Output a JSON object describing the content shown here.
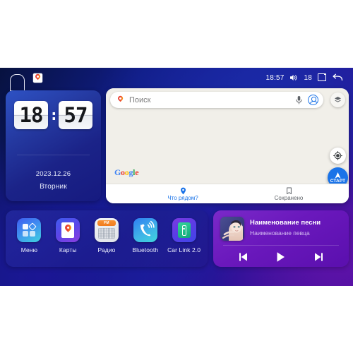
{
  "status_bar": {
    "home_icon": "home-icon",
    "maps_icon": "google-maps-icon",
    "time": "18:57",
    "volume_icon": "volume-icon",
    "volume_level": "18",
    "recents_icon": "recent-apps-icon",
    "back_icon": "back-arrow-icon"
  },
  "clock_widget": {
    "hours": "18",
    "separator": ":",
    "minutes": "57",
    "date": "2023.12.26",
    "weekday": "Вторник"
  },
  "map_card": {
    "search": {
      "placeholder": "Поиск",
      "pin_icon": "google-maps-pin-icon",
      "mic_icon": "microphone-icon",
      "avatar_icon": "account-avatar-icon"
    },
    "layers_icon": "map-layers-icon",
    "my_location_icon": "my-location-icon",
    "start_button_label": "СТАРТ",
    "start_button_icon": "navigation-arrow-icon",
    "google_logo": {
      "g": "G",
      "o1": "o",
      "o2": "o",
      "g2": "g",
      "l": "l",
      "e": "e"
    },
    "tabs": [
      {
        "label": "Что рядом?",
        "icon": "location-pin-icon"
      },
      {
        "label": "Сохранено",
        "icon": "bookmark-icon"
      }
    ]
  },
  "dock": {
    "apps": [
      {
        "label": "Меню",
        "icon": "app-grid-icon"
      },
      {
        "label": "Карты",
        "icon": "maps-app-icon"
      },
      {
        "label": "Радио",
        "icon": "radio-app-icon",
        "band": "FM"
      },
      {
        "label": "Bluetooth",
        "icon": "bluetooth-icon"
      },
      {
        "label": "Car Link 2.0",
        "icon": "car-link-icon"
      }
    ]
  },
  "media_player": {
    "album_art": "album-art-portrait",
    "title": "Наименование песни",
    "artist": "Наименование певца",
    "controls": [
      {
        "name": "previous-track-button"
      },
      {
        "name": "play-button"
      },
      {
        "name": "next-track-button"
      }
    ]
  },
  "colors": {
    "accent_blue": "#1a73e8",
    "screen_blue": "#1a1f9e",
    "media_purple": "#6a18bc",
    "map_surface": "#f1efe9"
  }
}
